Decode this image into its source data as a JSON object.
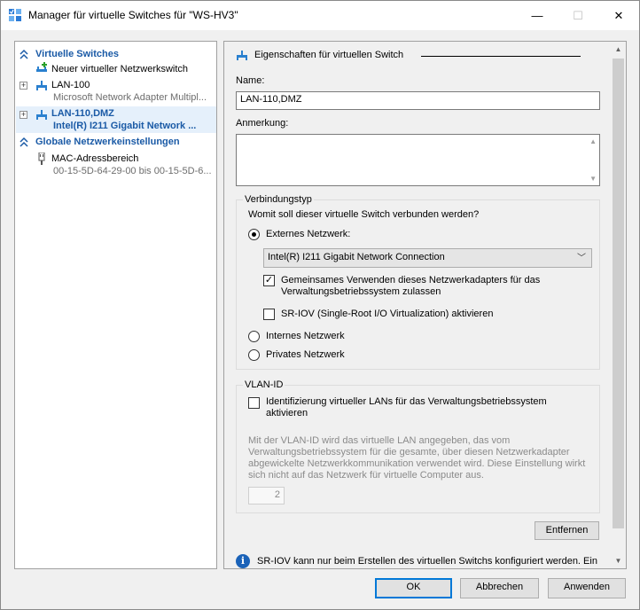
{
  "window": {
    "title": "Manager für virtuelle Switches für \"WS-HV3\"",
    "icon": "vswitch-manager-icon",
    "controls": {
      "minimize": "—",
      "maximize": "☐",
      "close": "✕"
    }
  },
  "left": {
    "virtual_switches_header": "Virtuelle Switches",
    "items": [
      {
        "title": "Neuer virtueller Netzwerkswitch",
        "subtitle": ""
      },
      {
        "title": "LAN-100",
        "subtitle": "Microsoft Network Adapter Multipl..."
      },
      {
        "title": "LAN-110,DMZ",
        "subtitle": "Intel(R) I211 Gigabit Network ..."
      }
    ],
    "global_header": "Globale Netzwerkeinstellungen",
    "global_items": [
      {
        "title": "MAC-Adressbereich",
        "subtitle": "00-15-5D-64-29-00 bis 00-15-5D-6..."
      }
    ]
  },
  "props": {
    "header": "Eigenschaften für virtuellen Switch",
    "name_label": "Name:",
    "name_value": "LAN-110,DMZ",
    "notes_label": "Anmerkung:",
    "notes_value": "",
    "connection": {
      "title": "Verbindungstyp",
      "question": "Womit soll dieser virtuelle Switch verbunden werden?",
      "external_label": "Externes Netzwerk:",
      "adapter": "Intel(R) I211 Gigabit Network Connection",
      "share_line1": "Gemeinsames Verwenden dieses Netzwerkadapters für das",
      "share_line2": "Verwaltungsbetriebssystem zulassen",
      "sriov_label": "SR-IOV (Single-Root I/O Virtualization) aktivieren",
      "internal_label": "Internes Netzwerk",
      "private_label": "Privates Netzwerk",
      "selected": "external",
      "share_checked": true,
      "sriov_checked": false
    },
    "vlan": {
      "title": "VLAN-ID",
      "checkbox_line1": "Identifizierung virtueller LANs für das Verwaltungsbetriebssystem",
      "checkbox_line2": "aktivieren",
      "checked": false,
      "help_line1": "Mit der VLAN-ID wird das virtuelle LAN angegeben, das vom",
      "help_line2": "Verwaltungsbetriebssystem für die gesamte, über diesen Netzwerkadapter",
      "help_line3": "abgewickelte Netzwerkkommunikation verwendet wird. Diese Einstellung wirkt",
      "help_line4": "sich nicht auf das Netzwerk für virtuelle Computer aus.",
      "id_value": "2"
    },
    "remove_button": "Entfernen",
    "info_text": "SR-IOV kann nur beim Erstellen des virtuellen Switchs konfiguriert werden. Ein"
  },
  "buttons": {
    "ok": "OK",
    "cancel": "Abbrechen",
    "apply": "Anwenden"
  },
  "colors": {
    "accent": "#1a5aa6",
    "selection": "#e5f0fb",
    "default_button_border": "#0078d7"
  }
}
